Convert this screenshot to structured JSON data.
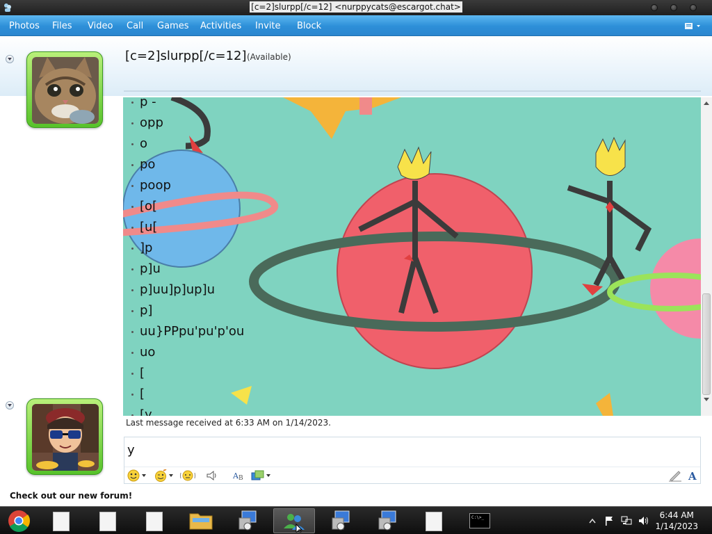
{
  "window": {
    "title": "[c=2]slurpp[/c=12] <nurppycats@escargot.chat>"
  },
  "menu": {
    "items": [
      "Photos",
      "Files",
      "Video",
      "Call",
      "Games",
      "Activities",
      "Invite",
      "Block"
    ]
  },
  "contact": {
    "name": "[c=2]slurpp[/c=12]",
    "status": "(Available)"
  },
  "conversation": {
    "messages": [
      "p -",
      "opp",
      "o",
      "po",
      "poop",
      "[o[",
      "[u[",
      "]p",
      "p]u",
      "p]uu]p]up]u",
      "p]",
      "uu}PPpu'pu'p'ou",
      "uo",
      "[",
      "[",
      "[y"
    ],
    "last_received": "Last message received at 6:33 AM on 1/14/2023."
  },
  "input": {
    "value": "y"
  },
  "footer": {
    "forum_link": "Check out our new forum!"
  },
  "taskbar": {
    "clock_time": "6:44 AM",
    "clock_date": "1/14/2023",
    "terminal_label": "C:\\>_"
  },
  "colors": {
    "menubar": "#2d8fd8",
    "avatar_frame": "#57c22a",
    "conversation_bg": "#7fd3c0"
  }
}
